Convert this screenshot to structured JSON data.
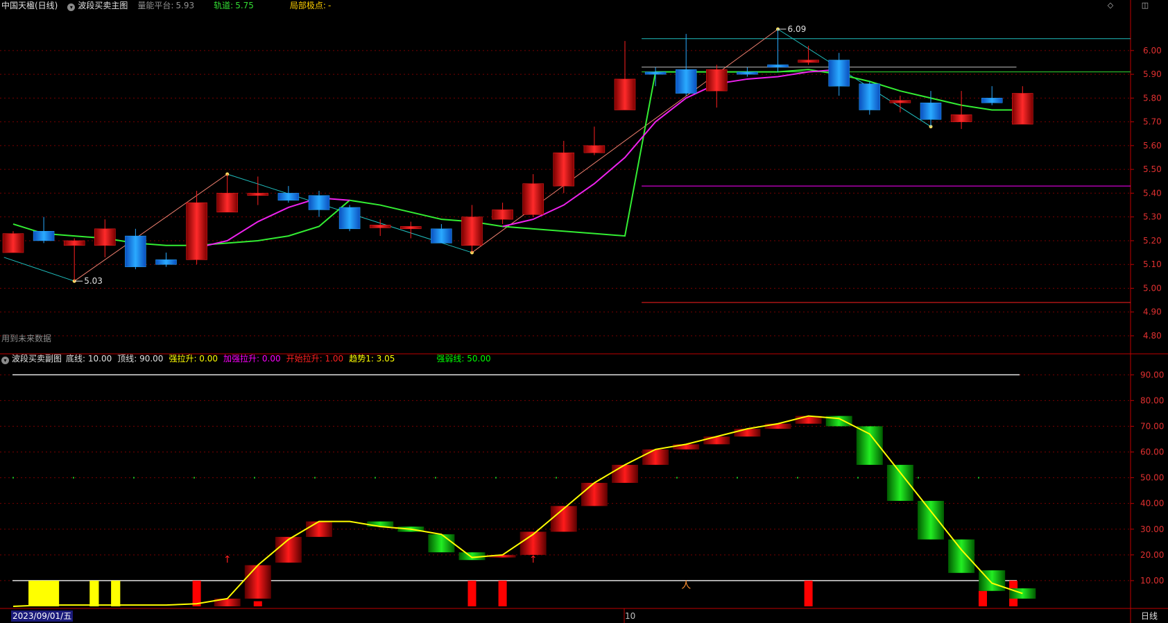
{
  "main_header": {
    "stock": "中国天楹(日线)",
    "indicator": "波段买卖主图",
    "platform_label": "量能平台:",
    "platform_value": "5.93",
    "track_label": "轨道:",
    "track_value": "5.75",
    "pivot_label": "局部极点:",
    "pivot_value": "-"
  },
  "future_note": "用到未来数据",
  "sub_header": {
    "indicator": "波段买卖副图",
    "items": [
      {
        "label": "底线:",
        "value": "10.00",
        "color": "#e0e0e0"
      },
      {
        "label": "顶线:",
        "value": "90.00",
        "color": "#e0e0e0"
      },
      {
        "label": "强拉升:",
        "value": "0.00",
        "color": "#ffff00"
      },
      {
        "label": "加强拉升:",
        "value": "0.00",
        "color": "#ff00ff"
      },
      {
        "label": "开始拉升:",
        "value": "1.00",
        "color": "#ff2020"
      },
      {
        "label": "趋势1:",
        "value": "3.05",
        "color": "#ffff00"
      },
      {
        "label": "强弱线:",
        "value": "50.00",
        "color": "#00ff00"
      }
    ]
  },
  "footer": {
    "date": "2023/09/01/五",
    "month_mark": "10",
    "period": "日线"
  },
  "icons": [
    "diamond-icon",
    "window-icon"
  ],
  "colors": {
    "up": "#ff1010",
    "down": "#1e90ff",
    "grid": "#7a0000",
    "axis": "#d00000"
  },
  "chart_data": [
    {
      "type": "candlestick",
      "name": "main",
      "ylim": [
        4.73,
        6.16
      ],
      "yticks": [
        "6.00",
        "5.90",
        "5.80",
        "5.70",
        "5.60",
        "5.50",
        "5.40",
        "5.30",
        "5.20",
        "5.10",
        "5.00",
        "4.90",
        "4.80"
      ],
      "candles": [
        {
          "o": 5.15,
          "c": 5.23,
          "h": 5.24,
          "l": 5.15
        },
        {
          "o": 5.24,
          "c": 5.2,
          "h": 5.3,
          "l": 5.19
        },
        {
          "o": 5.18,
          "c": 5.2,
          "h": 5.21,
          "l": 5.03
        },
        {
          "o": 5.18,
          "c": 5.25,
          "h": 5.29,
          "l": 5.13
        },
        {
          "o": 5.22,
          "c": 5.09,
          "h": 5.25,
          "l": 5.08
        },
        {
          "o": 5.12,
          "c": 5.1,
          "h": 5.15,
          "l": 5.09
        },
        {
          "o": 5.12,
          "c": 5.36,
          "h": 5.41,
          "l": 5.1
        },
        {
          "o": 5.32,
          "c": 5.4,
          "h": 5.48,
          "l": 5.32
        },
        {
          "o": 5.39,
          "c": 5.4,
          "h": 5.47,
          "l": 5.35
        },
        {
          "o": 5.4,
          "c": 5.37,
          "h": 5.43,
          "l": 5.36
        },
        {
          "o": 5.39,
          "c": 5.33,
          "h": 5.41,
          "l": 5.3
        },
        {
          "o": 5.34,
          "c": 5.25,
          "h": 5.35,
          "l": 5.24
        },
        {
          "o": 5.26,
          "c": 5.26,
          "h": 5.29,
          "l": 5.22
        },
        {
          "o": 5.25,
          "c": 5.26,
          "h": 5.28,
          "l": 5.21
        },
        {
          "o": 5.25,
          "c": 5.19,
          "h": 5.27,
          "l": 5.19
        },
        {
          "o": 5.18,
          "c": 5.3,
          "h": 5.35,
          "l": 5.15
        },
        {
          "o": 5.29,
          "c": 5.33,
          "h": 5.36,
          "l": 5.27
        },
        {
          "o": 5.31,
          "c": 5.44,
          "h": 5.48,
          "l": 5.3
        },
        {
          "o": 5.43,
          "c": 5.57,
          "h": 5.62,
          "l": 5.4
        },
        {
          "o": 5.57,
          "c": 5.6,
          "h": 5.68,
          "l": 5.56
        },
        {
          "o": 5.75,
          "c": 5.88,
          "h": 6.04,
          "l": 5.75
        },
        {
          "o": 5.91,
          "c": 5.9,
          "h": 5.93,
          "l": 5.85
        },
        {
          "o": 5.92,
          "c": 5.82,
          "h": 6.07,
          "l": 5.81
        },
        {
          "o": 5.83,
          "c": 5.92,
          "h": 5.94,
          "l": 5.76
        },
        {
          "o": 5.91,
          "c": 5.9,
          "h": 5.93,
          "l": 5.89
        },
        {
          "o": 5.94,
          "c": 5.93,
          "h": 6.09,
          "l": 5.91
        },
        {
          "o": 5.95,
          "c": 5.96,
          "h": 6.02,
          "l": 5.94
        },
        {
          "o": 5.96,
          "c": 5.85,
          "h": 5.99,
          "l": 5.81
        },
        {
          "o": 5.86,
          "c": 5.75,
          "h": 5.87,
          "l": 5.73
        },
        {
          "o": 5.78,
          "c": 5.79,
          "h": 5.81,
          "l": 5.74
        },
        {
          "o": 5.78,
          "c": 5.71,
          "h": 5.83,
          "l": 5.68
        },
        {
          "o": 5.7,
          "c": 5.73,
          "h": 5.83,
          "l": 5.67
        },
        {
          "o": 5.8,
          "c": 5.78,
          "h": 5.85,
          "l": 5.77
        },
        {
          "o": 5.69,
          "c": 5.82,
          "h": 5.85,
          "l": 5.69
        }
      ],
      "ma_green": [
        5.27,
        5.23,
        5.22,
        5.21,
        5.19,
        5.18,
        5.18,
        5.19,
        5.2,
        5.22,
        5.26,
        5.37,
        5.35,
        5.32,
        5.29,
        5.28,
        5.26,
        5.25,
        5.24,
        5.23,
        5.22,
        5.91,
        5.91,
        5.91,
        5.91,
        5.91,
        5.92,
        5.9,
        5.87,
        5.83,
        5.8,
        5.77,
        5.75,
        5.75
      ],
      "ma_magenta": [
        null,
        null,
        null,
        null,
        null,
        null,
        5.17,
        5.2,
        5.28,
        5.34,
        5.38,
        5.37,
        null,
        null,
        null,
        null,
        5.26,
        5.29,
        5.35,
        5.44,
        5.55,
        5.7,
        5.8,
        5.86,
        5.88,
        5.89,
        5.91,
        5.92,
        null,
        null,
        null,
        null,
        null,
        null
      ],
      "zigzag": [
        {
          "i": -0.3,
          "v": 5.13
        },
        {
          "i": 2,
          "v": 5.03
        },
        {
          "i": 7,
          "v": 5.48
        },
        {
          "i": 15,
          "v": 5.15
        },
        {
          "i": 25,
          "v": 6.09
        },
        {
          "i": 30,
          "v": 5.68
        }
      ],
      "pivot_labels": [
        {
          "i": 2,
          "v": 5.03,
          "text": "5.03"
        },
        {
          "i": 25,
          "v": 6.09,
          "text": "6.09"
        }
      ],
      "hlines": [
        {
          "v": 6.05,
          "from": 21,
          "color": "#20c0c0"
        },
        {
          "v": 5.93,
          "from": 21,
          "to": 32.8,
          "color": "#c0c0c0"
        },
        {
          "v": 5.91,
          "from": 21,
          "color": "#33dd33"
        },
        {
          "v": 5.43,
          "from": 21,
          "color": "#ff00ff"
        },
        {
          "v": 4.94,
          "from": 21,
          "color": "#ff2020"
        }
      ]
    },
    {
      "type": "indicator",
      "name": "sub",
      "ylim": [
        0,
        96
      ],
      "yticks": [
        "90.00",
        "80.00",
        "70.00",
        "60.00",
        "50.00",
        "40.00",
        "30.00",
        "20.00",
        "10.00"
      ],
      "base_line": 10,
      "top_line": 90,
      "strength_line": 50,
      "trend_line": [
        0,
        0.5,
        0.5,
        0.5,
        0.5,
        0.5,
        1,
        3,
        16,
        26,
        33,
        33,
        31,
        30,
        28,
        19,
        20,
        28,
        38,
        48,
        55,
        61,
        63,
        66,
        69,
        71,
        74,
        73,
        67,
        52,
        37,
        22,
        9,
        5
      ],
      "bars": [
        null,
        null,
        null,
        null,
        null,
        null,
        null,
        [
          0,
          3
        ],
        [
          3,
          16
        ],
        [
          17,
          27
        ],
        [
          27,
          33
        ],
        null,
        [
          31,
          33
        ],
        [
          29,
          31
        ],
        [
          21,
          28
        ],
        [
          18,
          21
        ],
        [
          19,
          20
        ],
        [
          20,
          29
        ],
        [
          29,
          39
        ],
        [
          39,
          48
        ],
        [
          48,
          55
        ],
        [
          55,
          61
        ],
        [
          61,
          63
        ],
        [
          63,
          66
        ],
        [
          66,
          69
        ],
        [
          69,
          71
        ],
        [
          71,
          74
        ],
        [
          70,
          74
        ],
        [
          55,
          70
        ],
        [
          41,
          55
        ],
        [
          26,
          41
        ],
        [
          13,
          26
        ],
        [
          6,
          14
        ],
        [
          3,
          7
        ]
      ],
      "bar_dir": [
        "",
        "",
        "",
        "",
        "",
        "",
        "",
        "up",
        "up",
        "up",
        "up",
        "",
        "down",
        "down",
        "down",
        "down",
        "up",
        "up",
        "up",
        "up",
        "up",
        "up",
        "up",
        "up",
        "up",
        "up",
        "up",
        "down",
        "down",
        "down",
        "down",
        "down",
        "down",
        "down"
      ],
      "yellow_blocks": [
        [
          0.5,
          1.5
        ],
        [
          2.5,
          2.8
        ],
        [
          3.2,
          3.5
        ]
      ],
      "red_blocks": [
        [
          6,
          10
        ],
        [
          8,
          2
        ],
        [
          26,
          10
        ],
        [
          15,
          10
        ],
        [
          16,
          10
        ],
        [
          31.7,
          6
        ],
        [
          32.7,
          10
        ]
      ],
      "arrows": [
        {
          "i": 7,
          "v": 17,
          "symbol": "↑"
        },
        {
          "i": 17,
          "v": 17,
          "symbol": "↑"
        },
        {
          "i": 22,
          "v": 7,
          "symbol": "人"
        }
      ]
    }
  ]
}
